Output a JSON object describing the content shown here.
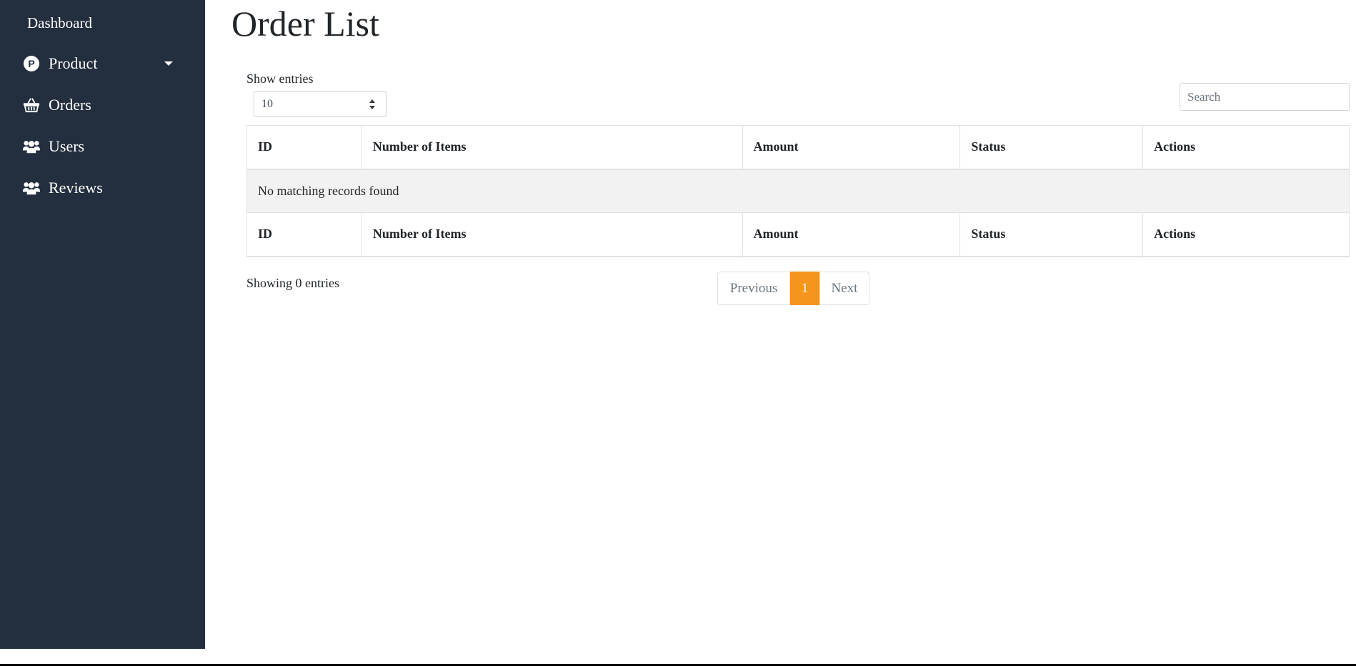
{
  "sidebar": {
    "dashboard_label": "Dashboard",
    "product_label": "Product",
    "orders_label": "Orders",
    "users_label": "Users",
    "reviews_label": "Reviews",
    "product_icon_letter": "P",
    "icons": {
      "product": "product-circle-icon",
      "orders": "basket-icon",
      "users": "users-icon",
      "reviews": "users-icon"
    },
    "background": "#232f3e"
  },
  "page": {
    "title": "Order List"
  },
  "controls": {
    "show_entries_label": "Show entries",
    "entries_value": "10",
    "search_placeholder": "Search"
  },
  "table": {
    "columns": [
      "ID",
      "Number of Items",
      "Amount",
      "Status",
      "Actions"
    ],
    "empty_message": "No matching records found"
  },
  "footer": {
    "info": "Showing 0 entries",
    "previous_label": "Previous",
    "current_page": "1",
    "next_label": "Next",
    "accent": "#f6951e"
  }
}
